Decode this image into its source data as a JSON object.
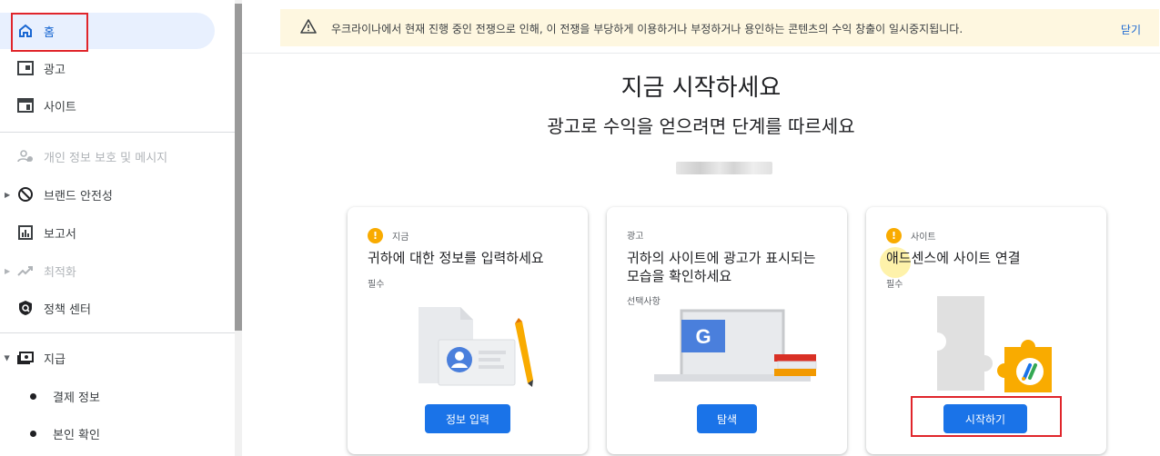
{
  "sidebar": {
    "items": [
      {
        "label": "홈"
      },
      {
        "label": "광고"
      },
      {
        "label": "사이트"
      },
      {
        "label": "개인 정보 보호 및 메시지"
      },
      {
        "label": "브랜드 안전성"
      },
      {
        "label": "보고서"
      },
      {
        "label": "최적화"
      },
      {
        "label": "정책 센터"
      },
      {
        "label": "지급"
      },
      {
        "label": "결제 정보"
      },
      {
        "label": "본인 확인"
      }
    ]
  },
  "banner": {
    "message": "우크라이나에서 현재 진행 중인 전쟁으로 인해, 이 전쟁을 부당하게 이용하거나 부정하거나 용인하는 콘텐츠의 수익 창출이 일시중지됩니다.",
    "close_label": "닫기"
  },
  "main": {
    "title": "지금 시작하세요",
    "subtitle": "광고로 수익을 얻으려면 단계를 따르세요"
  },
  "cards": [
    {
      "tag": "지금",
      "title": "귀하에 대한 정보를 입력하세요",
      "requirement": "필수",
      "button": "정보 입력"
    },
    {
      "tag": "광고",
      "title": "귀하의 사이트에 광고가 표시되는 모습을 확인하세요",
      "requirement": "선택사항",
      "button": "탐색"
    },
    {
      "tag": "사이트",
      "title": "애드센스에 사이트 연결",
      "requirement": "필수",
      "button": "시작하기"
    }
  ],
  "illustration": {
    "g_letter": "G"
  },
  "colors": {
    "accent": "#1a73e8",
    "warning": "#f9ab00",
    "banner_bg": "#fef7e0",
    "annotation": "#e0252b"
  }
}
